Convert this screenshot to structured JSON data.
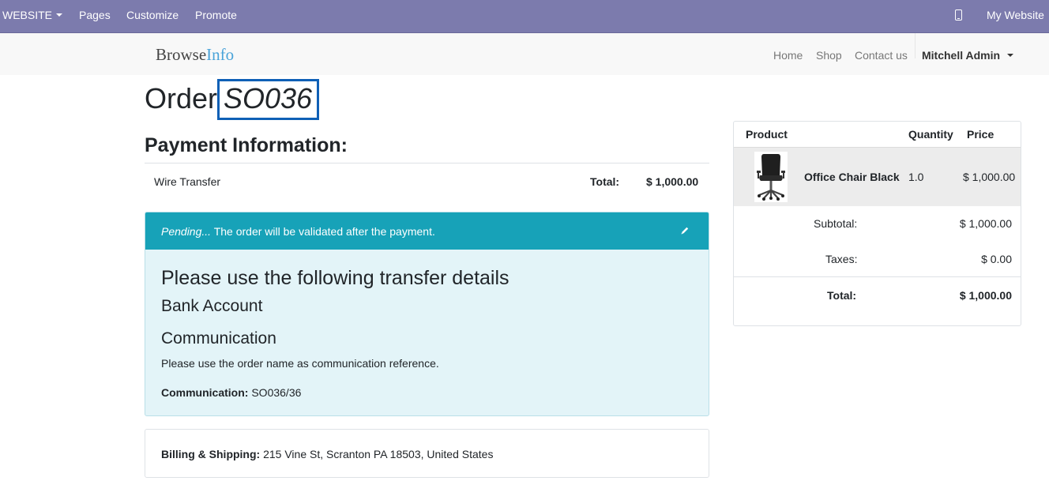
{
  "admin_bar": {
    "website_label": "WEBSITE",
    "pages_label": "Pages",
    "customize_label": "Customize",
    "promote_label": "Promote",
    "device_icon": "mobile-icon",
    "my_website_label": "My Website"
  },
  "navbar": {
    "brand_main": "Browse",
    "brand_accent": "Info",
    "links": [
      "Home",
      "Shop",
      "Contact us"
    ],
    "user": "Mitchell Admin"
  },
  "order": {
    "prefix": "Order",
    "number": "SO036"
  },
  "payment": {
    "heading": "Payment Information:",
    "method": "Wire Transfer",
    "total_label": "Total:",
    "total_value": "$ 1,000.00"
  },
  "alert": {
    "pending_em": "Pending...",
    "pending_text": " The order will be validated after the payment.",
    "edit_icon": "pencil-icon",
    "title": "Please use the following transfer details",
    "bank_heading": "Bank Account",
    "comm_heading": "Communication",
    "comm_text": "Please use the order name as communication reference.",
    "comm_label": "Communication:",
    "comm_value": " SO036/36"
  },
  "billing": {
    "label": "Billing & Shipping:",
    "address": " 215 Vine St, Scranton PA 18503, United States"
  },
  "summary": {
    "headers": {
      "product": "Product",
      "quantity": "Quantity",
      "price": "Price"
    },
    "item": {
      "name": "Office Chair Black",
      "quantity": "1.0",
      "price": "$ 1,000.00",
      "image": "office-chair-image"
    },
    "subtotal_label": "Subtotal:",
    "subtotal_value": "$ 1,000.00",
    "taxes_label": "Taxes:",
    "taxes_value": "$ 0.00",
    "total_label": "Total:",
    "total_value": "$ 1,000.00"
  },
  "colors": {
    "admin_bar": "#7c7bad",
    "alert_header": "#17a2b8",
    "alert_body": "#e3f4f8",
    "order_highlight": "#0f60b6"
  }
}
